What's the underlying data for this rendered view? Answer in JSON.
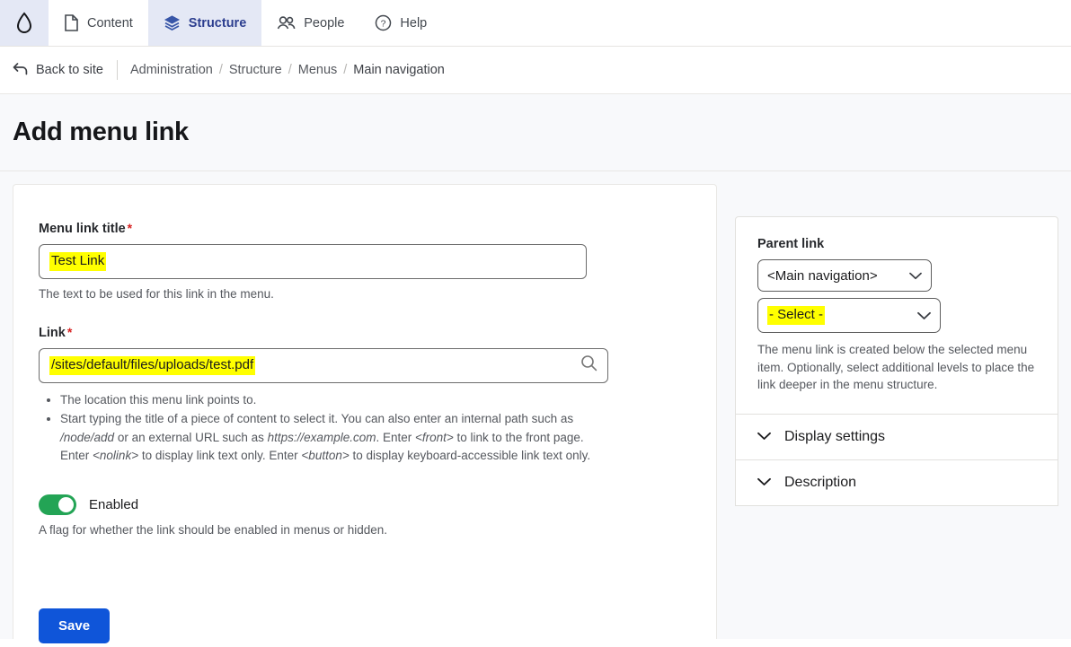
{
  "nav": {
    "logo": "drupal-droplet-logo",
    "tabs": [
      {
        "label": "Content",
        "icon": "document-icon",
        "active": false
      },
      {
        "label": "Structure",
        "icon": "layers-icon",
        "active": true
      },
      {
        "label": "People",
        "icon": "people-icon",
        "active": false
      },
      {
        "label": "Help",
        "icon": "question-circle-icon",
        "active": false
      }
    ]
  },
  "breadcrumb": {
    "back_label": "Back to site",
    "back_icon": "back-arrow-icon",
    "items": [
      "Administration",
      "Structure",
      "Menus",
      "Main navigation"
    ],
    "separator": "/"
  },
  "page": {
    "title": "Add menu link"
  },
  "form": {
    "title_field": {
      "label": "Menu link title",
      "required_marker": "*",
      "value": "Test Link",
      "description": "The text to be used for this link in the menu.",
      "highlighted": true
    },
    "link_field": {
      "label": "Link",
      "required_marker": "*",
      "value": "/sites/default/files/uploads/test.pdf",
      "icon": "search-icon",
      "highlighted": true,
      "help": [
        "The location this menu link points to.",
        "Start typing the title of a piece of content to select it. You can also enter an internal path such as /node/add or an external URL such as https://example.com. Enter <front> to link to the front page. Enter <nolink> to display link text only. Enter <button> to display keyboard-accessible link text only."
      ],
      "help_parts": {
        "p1": "Start typing the title of a piece of content to select it. You can also enter an internal path such as ",
        "i1": "/node/add",
        "p2": " or an external URL such as ",
        "i2": "https://example.com",
        "p3": ". Enter ",
        "i3": "<front>",
        "p4": " to link to the front page. Enter ",
        "i4": "<nolink>",
        "p5": " to display link text only. Enter ",
        "i5": "<button>",
        "p6": " to display keyboard-accessible link text only."
      }
    },
    "enabled_toggle": {
      "label": "Enabled",
      "state": "on",
      "description": "A flag for whether the link should be enabled in menus or hidden."
    },
    "save_label": "Save"
  },
  "sidebar": {
    "parent_link": {
      "label": "Parent link",
      "select_primary": "<Main navigation>",
      "select_secondary": "- Select -",
      "secondary_highlighted": true,
      "description": "The menu link is created below the selected menu item. Optionally, select additional levels to place the link deeper in the menu structure."
    },
    "accordions": [
      {
        "label": "Display settings",
        "icon": "chevron-down-icon",
        "expanded": false
      },
      {
        "label": "Description",
        "icon": "chevron-down-icon",
        "expanded": false
      }
    ]
  },
  "colors": {
    "accent_blue": "#0f55d9",
    "active_tab_bg": "#e4e8f5",
    "active_tab_text": "#2c3e8f",
    "toggle_on": "#23a455",
    "highlight_yellow": "#ffff00",
    "required_red": "#d72222",
    "page_bg": "#f8f9fb"
  }
}
